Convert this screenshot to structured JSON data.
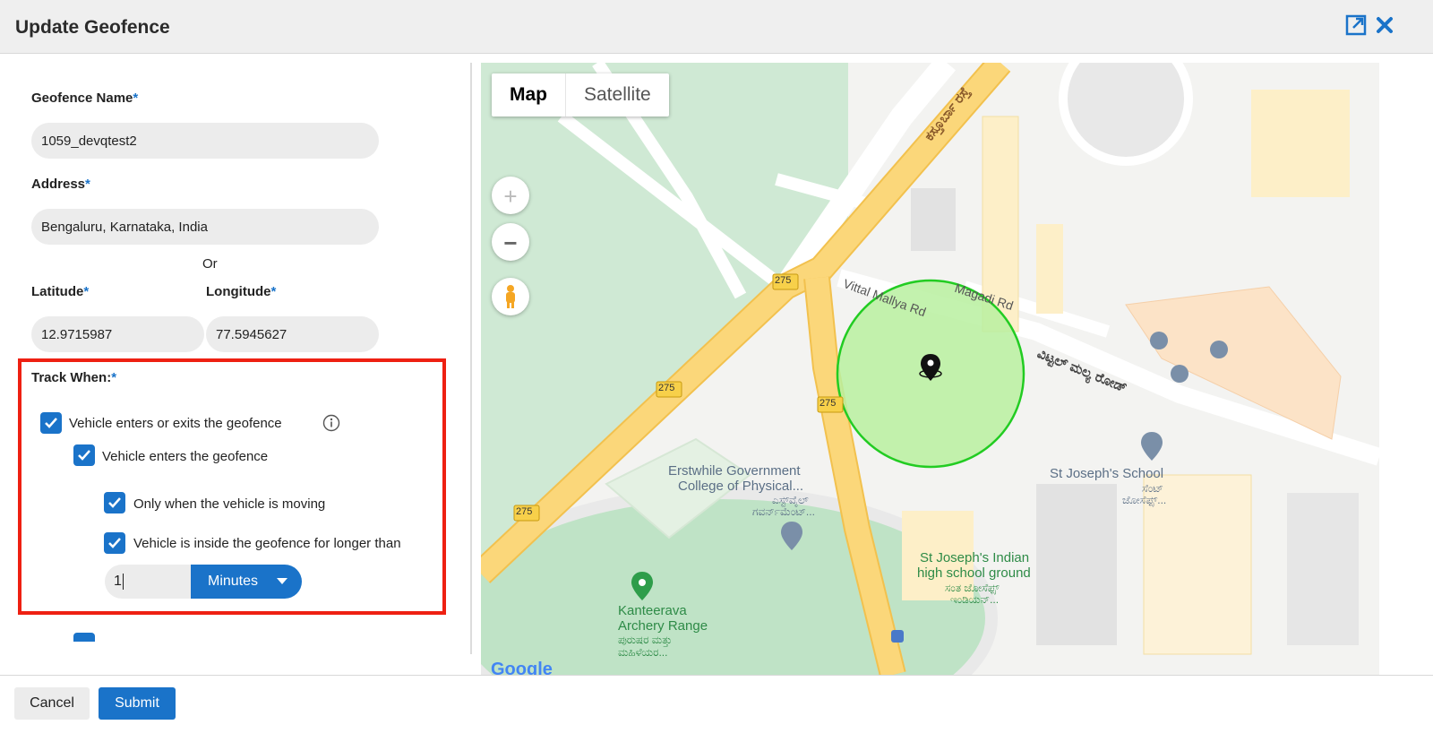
{
  "dialog": {
    "title": "Update Geofence",
    "expand_icon": "expand-icon",
    "close_icon": "close-icon"
  },
  "form": {
    "name_label": "Geofence Name",
    "name_value": "1059_devqtest2",
    "address_label": "Address",
    "address_value": "Bengaluru, Karnataka, India",
    "or_text": "Or",
    "latitude_label": "Latitude",
    "latitude_value": "12.9715987",
    "longitude_label": "Longitude",
    "longitude_value": "77.5945627",
    "required_mark": "*"
  },
  "track": {
    "label": "Track When:",
    "options": [
      {
        "label": "Vehicle enters or exits the geofence",
        "checked": true,
        "info_icon": "info-icon"
      },
      {
        "label": "Vehicle enters the geofence",
        "checked": true
      },
      {
        "label": "Only when the vehicle is moving",
        "checked": true
      },
      {
        "label": "Vehicle is inside the geofence for longer than",
        "checked": true
      }
    ],
    "duration_value": "1",
    "duration_unit": "Minutes"
  },
  "map": {
    "type_buttons": [
      "Map",
      "Satellite"
    ],
    "selected_type": "Map",
    "zoom_in": "+",
    "zoom_out": "−",
    "pegman_icon": "pegman-icon",
    "labels": {
      "road_vittal": "Vittal Mallya Rd",
      "road_magadi": "Magadi Rd",
      "road_vittal_kn": "ವಿಟ್ಟಲ್ ಮಲ್ಯ ರೋಡ್",
      "road_kasturba_kn": "ಕಸ್ತೂರ್ಬಾ ರಸ್ತೆ",
      "route_275": "275",
      "college_1": "Erstwhile Government",
      "college_2": "College of Physical...",
      "college_kn_1": "ಎಸ್ಟ್‌ವೈಲ್",
      "college_kn_2": "ಗವರ್ನ್‌ಮೆಂಟ್...",
      "school_1": "St Joseph's School",
      "school_kn_1": "ಸೆಂಟ್",
      "school_kn_2": "ಜೋಸೆಫ್ಸ್...",
      "ground_1": "St Joseph's Indian",
      "ground_2": "high school ground",
      "ground_kn_1": "ಸಂತ ಜೋಸೆಫ್ಸ್",
      "ground_kn_2": "ಇಂಡಿಯನ್...",
      "archery_1": "Kanteerava",
      "archery_2": "Archery Range",
      "archery_kn_1": "ಪುರುಷರ ಮತ್ತು",
      "archery_kn_2": "ಮಹಿಳೆಯರ...",
      "google_logo": "Google"
    },
    "colors": {
      "geofence_fill": "#b8f0a0",
      "geofence_stroke": "#22cc22",
      "road_major": "#fbd77a",
      "park": "#c9e8cf"
    }
  },
  "footer": {
    "cancel": "Cancel",
    "submit": "Submit"
  }
}
